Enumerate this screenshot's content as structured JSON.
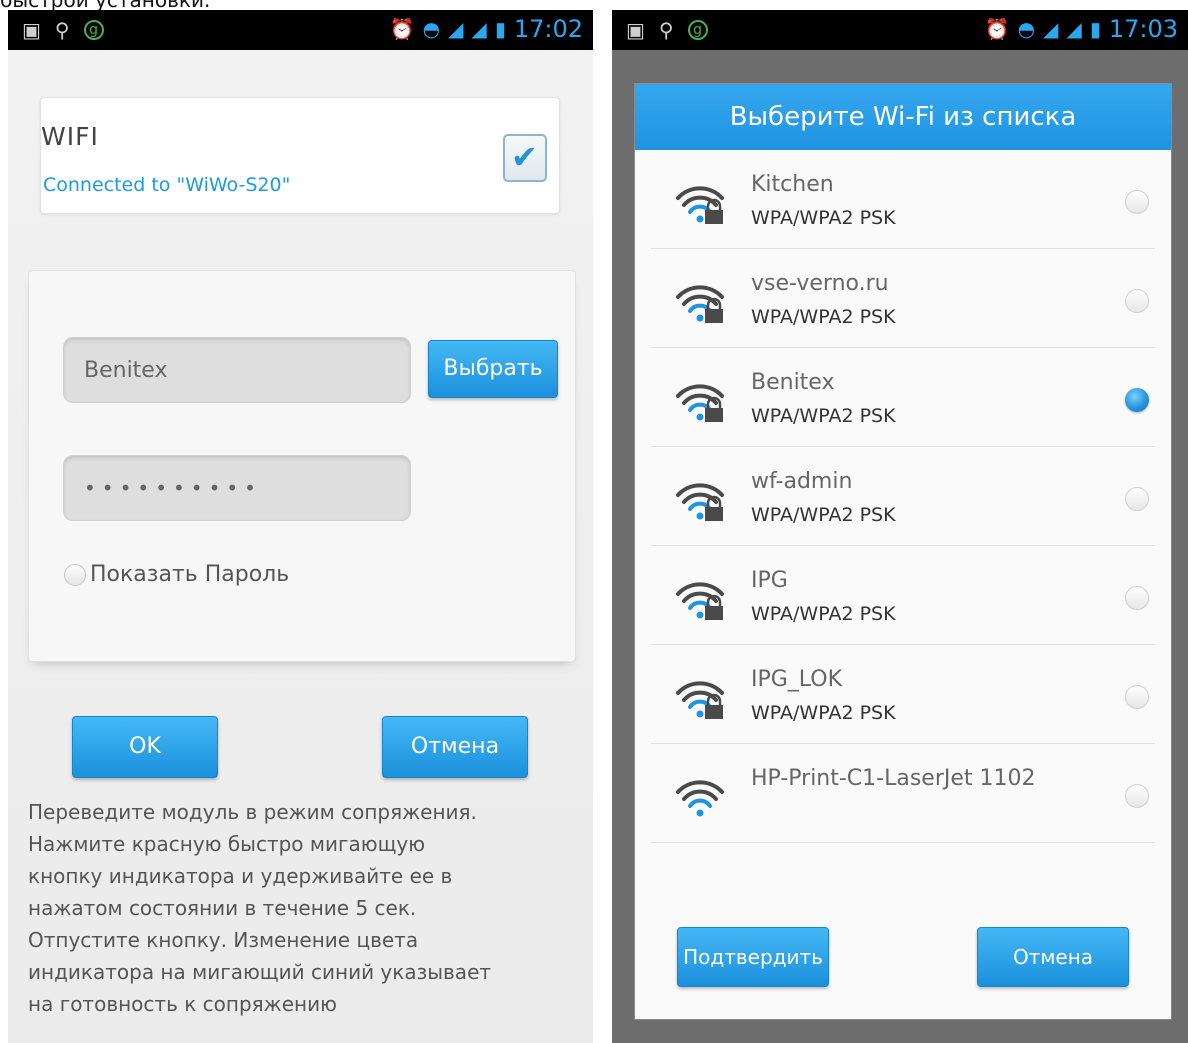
{
  "page_caption": "быстрой установки.",
  "left": {
    "status_time": "17:02",
    "wifi": {
      "title": "WIFI",
      "status": "Connected to \"WiWo-S20\"",
      "checked": true
    },
    "ssid_value": "Benitex",
    "choose_label": "Выбрать",
    "password_value": "••••••••••",
    "show_password_label": "Показать Пароль",
    "ok_label": "OK",
    "cancel_label": "Отмена",
    "instructions": [
      "Переведите модуль в режим сопряжения.",
      "Нажмите красную быстро мигающую",
      "кнопку индикатора и удерживайте ее в",
      "нажатом состоянии в течение 5 сек.",
      "Отпустите кнопку. Изменение цвета",
      "индикатора на мигающий синий указывает",
      "на готовность к сопряжению"
    ]
  },
  "right": {
    "status_time": "17:03",
    "dialog_title": "Выберите Wi-Fi из списка",
    "networks": [
      {
        "name": "Kitchen",
        "security": "WPA/WPA2 PSK",
        "locked": true,
        "selected": false
      },
      {
        "name": "vse-verno.ru",
        "security": "WPA/WPA2 PSK",
        "locked": true,
        "selected": false
      },
      {
        "name": "Benitex",
        "security": "WPA/WPA2 PSK",
        "locked": true,
        "selected": true
      },
      {
        "name": "wf-admin",
        "security": "WPA/WPA2 PSK",
        "locked": true,
        "selected": false
      },
      {
        "name": "IPG",
        "security": "WPA/WPA2 PSK",
        "locked": true,
        "selected": false
      },
      {
        "name": "IPG_LOK",
        "security": "WPA/WPA2 PSK",
        "locked": true,
        "selected": false
      },
      {
        "name": "HP-Print-C1-LaserJet 1102",
        "security": "",
        "locked": false,
        "selected": false
      }
    ],
    "confirm_label": "Подтвердить",
    "cancel_label": "Отмена"
  },
  "colors": {
    "accent": "#1f94e0",
    "status_text": "#2aa7ee",
    "wifi_icon_dark": "#4a4a4a",
    "wifi_icon_blue": "#1f94e0"
  }
}
